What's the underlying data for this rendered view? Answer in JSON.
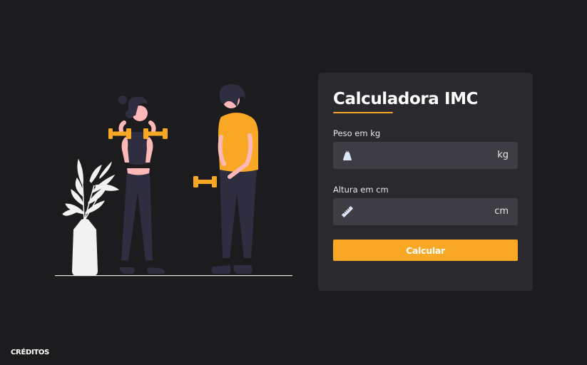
{
  "form": {
    "title": "Calculadora IMC",
    "weight_label": "Peso em kg",
    "weight_value": "",
    "weight_unit": "kg",
    "height_label": "Altura em cm",
    "height_value": "",
    "height_unit": "cm",
    "submit_label": "Calcular"
  },
  "footer": {
    "credits_label": "CRÉDITOS"
  },
  "icons": {
    "weight": "weight-icon",
    "height": "ruler-icon"
  },
  "colors": {
    "background": "#1c1b1d",
    "card": "#2a292d",
    "input": "#3e3d43",
    "accent": "#f9a826"
  }
}
